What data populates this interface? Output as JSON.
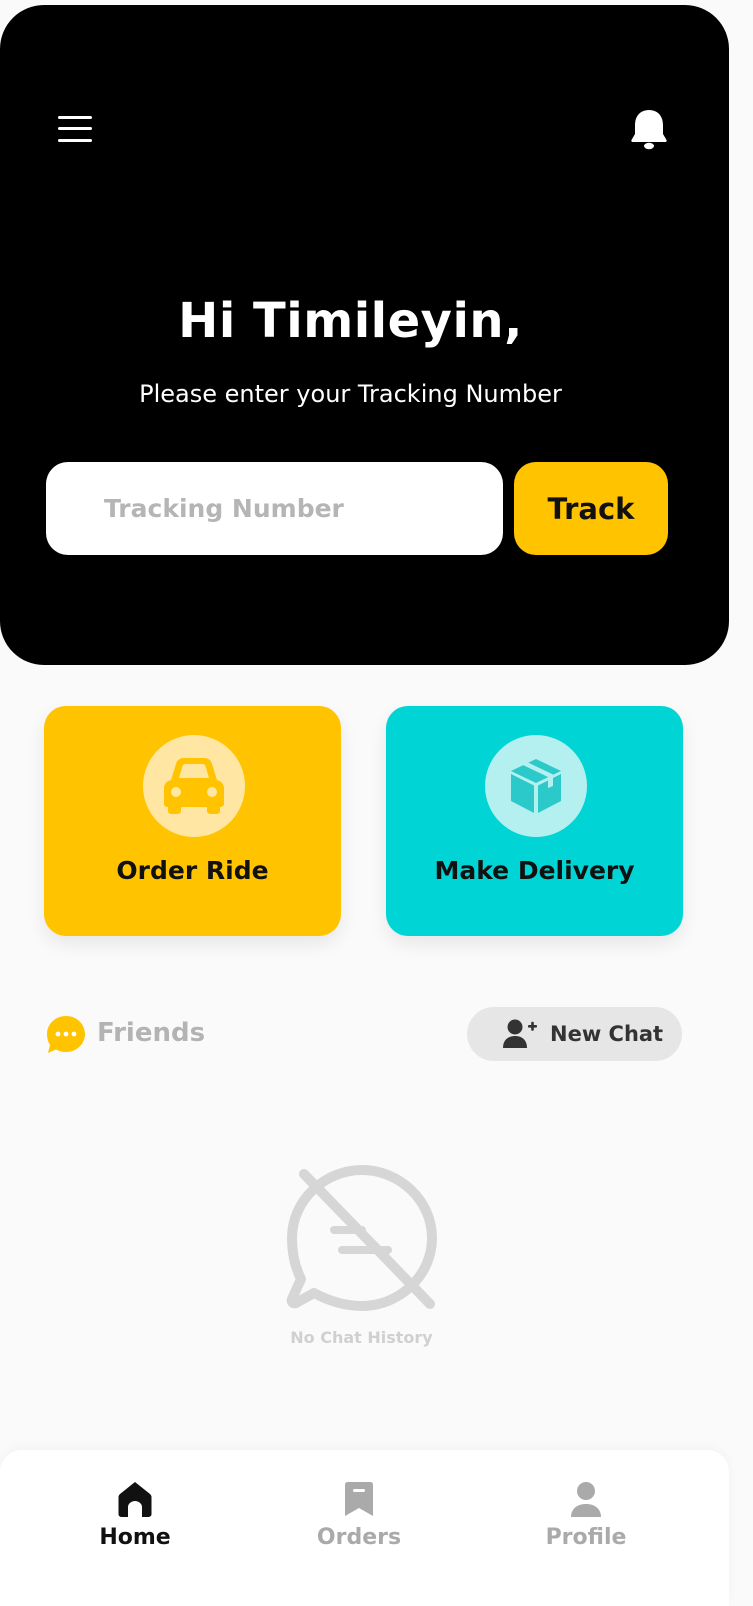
{
  "header": {
    "greeting": "Hi Timileyin,",
    "subtitle": "Please enter your Tracking Number",
    "tracking_placeholder": "Tracking Number",
    "tracking_value": "",
    "track_button_label": "Track"
  },
  "actions": {
    "order_ride_label": "Order Ride",
    "make_delivery_label": "Make Delivery"
  },
  "friends": {
    "title": "Friends",
    "new_chat_label": "New Chat",
    "empty_state": "No Chat History"
  },
  "bottom_nav": {
    "items": [
      {
        "label": "Home",
        "icon": "home-icon",
        "active": true
      },
      {
        "label": "Orders",
        "icon": "bookmark-icon",
        "active": false
      },
      {
        "label": "Profile",
        "icon": "user-icon",
        "active": false
      }
    ]
  },
  "colors": {
    "accent_yellow": "#ffc300",
    "accent_teal": "#00d4d4",
    "header_bg": "#000000",
    "page_bg": "#fafafa"
  }
}
